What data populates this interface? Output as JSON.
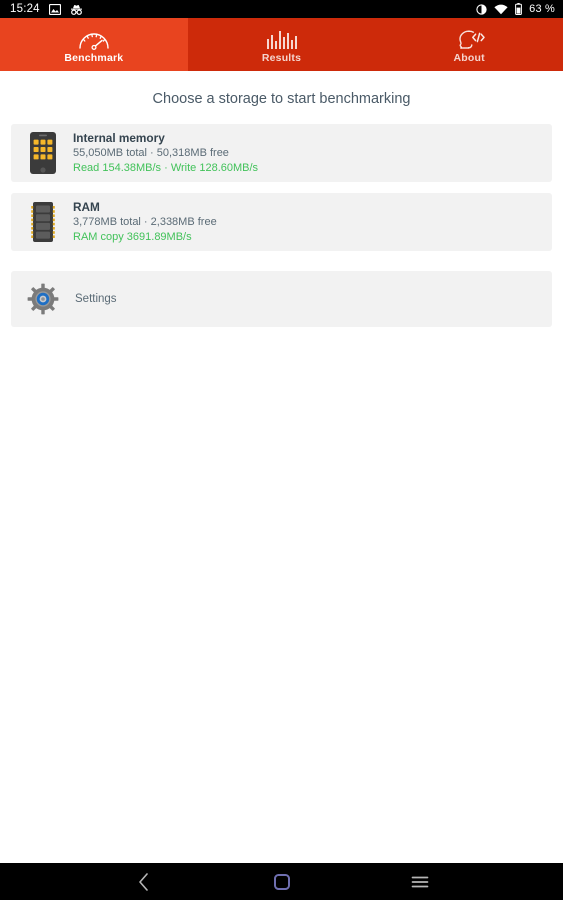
{
  "statusbar": {
    "clock": "15:24",
    "left_icons": [
      "screenshot-icon",
      "incognito-icon"
    ],
    "right_icons": [
      "dnd-icon",
      "wifi-icon",
      "battery-icon"
    ],
    "battery_text": "63 %"
  },
  "tabs": [
    {
      "label": "Benchmark",
      "icon": "speedometer-icon",
      "selected": true
    },
    {
      "label": "Results",
      "icon": "bar-chart-icon",
      "selected": false
    },
    {
      "label": "About",
      "icon": "developer-head-icon",
      "selected": false
    }
  ],
  "headline": "Choose a storage to start benchmarking",
  "storages": [
    {
      "name": "Internal memory",
      "capacity": "55,050MB total · 50,318MB free",
      "speed": "Read 154.38MB/s · Write 128.60MB/s",
      "icon": "phone-storage-icon"
    },
    {
      "name": "RAM",
      "capacity": "3,778MB total · 2,338MB free",
      "speed": "RAM copy 3691.89MB/s",
      "icon": "ram-stick-icon"
    }
  ],
  "settings": {
    "label": "Settings",
    "icon": "gear-icon"
  },
  "navbar": {
    "back": "back-icon",
    "home": "home-icon",
    "recents": "menu-icon"
  },
  "colors": {
    "tab_selected": "#e8441f",
    "tab_bar": "#cd2a0a",
    "speed_green": "#42c25a",
    "card_bg": "#f2f2f2",
    "headline": "#4a5a67",
    "home_outline": "#6f6fb0"
  }
}
